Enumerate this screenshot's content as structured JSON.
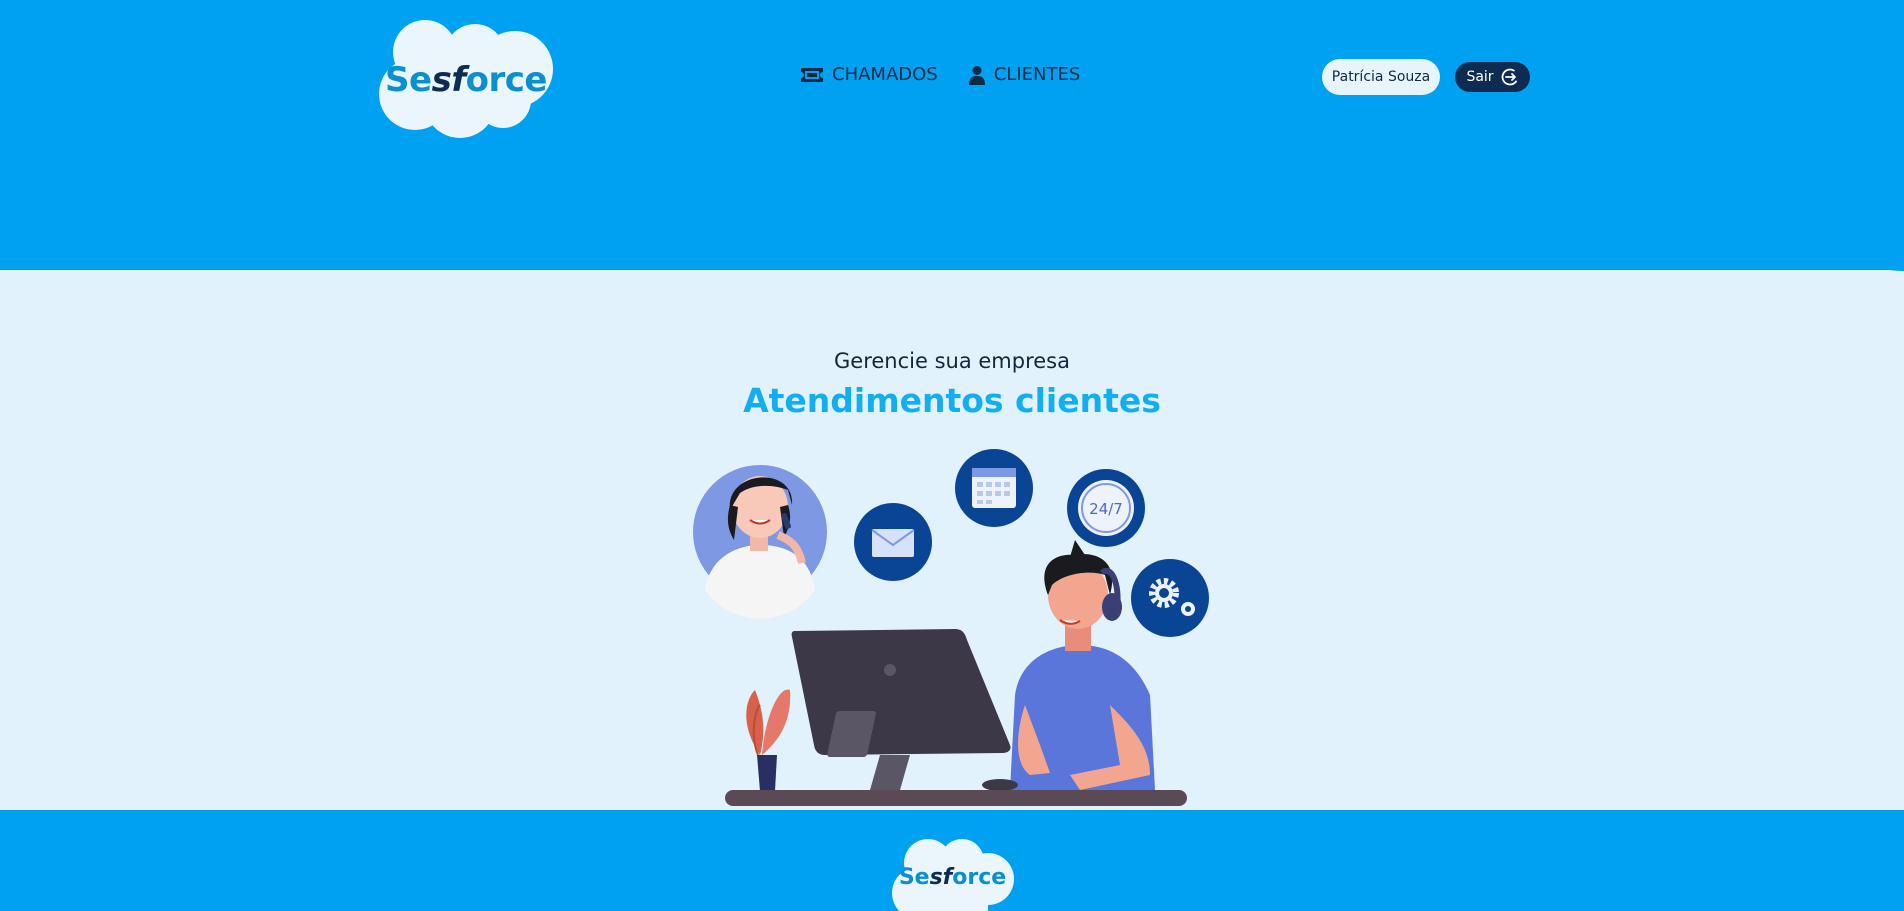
{
  "brand": {
    "logo_prefix": "Se",
    "logo_mid": "sf",
    "logo_suffix": "orce"
  },
  "nav": {
    "items": [
      {
        "label": "CHAMADOS",
        "icon": "ticket-icon"
      },
      {
        "label": "CLIENTES",
        "icon": "user-icon"
      }
    ]
  },
  "user": {
    "name": "Patrícia Souza"
  },
  "logout": {
    "label": "Sair",
    "icon": "logout-icon"
  },
  "hero": {
    "subtitle": "Gerencie sua empresa",
    "title": "Atendimentos clientes",
    "badge_247": "24/7"
  },
  "colors": {
    "header": "#00a1f1",
    "background": "#e1f2fc",
    "accent": "#12aef0",
    "dark": "#0e2c52"
  }
}
